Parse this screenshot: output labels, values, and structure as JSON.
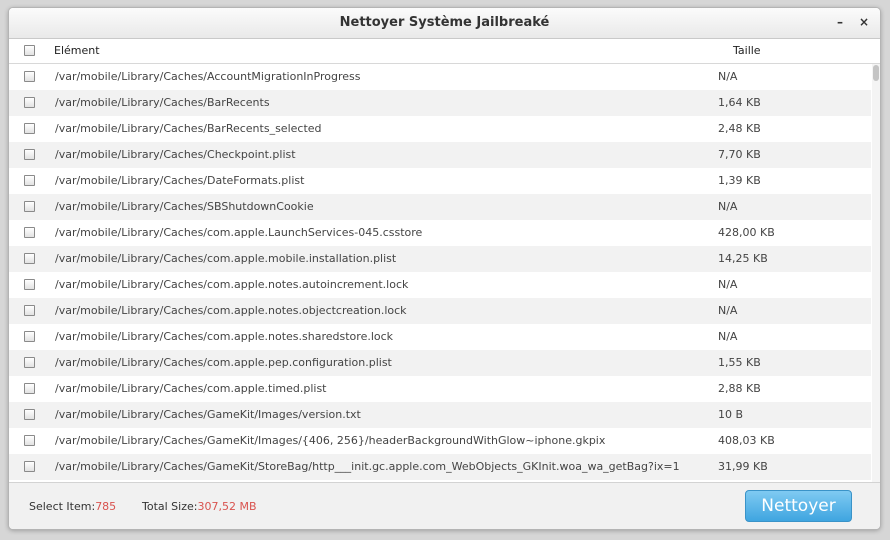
{
  "window": {
    "title": "Nettoyer Système Jailbreaké",
    "minimize": "–",
    "close": "×"
  },
  "table": {
    "col_item": "Elément",
    "col_size": "Taille",
    "rows": [
      {
        "path": "/var/mobile/Library/Caches/AccountMigrationInProgress",
        "size": "N/A"
      },
      {
        "path": "/var/mobile/Library/Caches/BarRecents",
        "size": "1,64 KB"
      },
      {
        "path": "/var/mobile/Library/Caches/BarRecents_selected",
        "size": "2,48 KB"
      },
      {
        "path": "/var/mobile/Library/Caches/Checkpoint.plist",
        "size": "7,70 KB"
      },
      {
        "path": "/var/mobile/Library/Caches/DateFormats.plist",
        "size": "1,39 KB"
      },
      {
        "path": "/var/mobile/Library/Caches/SBShutdownCookie",
        "size": "N/A"
      },
      {
        "path": "/var/mobile/Library/Caches/com.apple.LaunchServices-045.csstore",
        "size": "428,00 KB"
      },
      {
        "path": "/var/mobile/Library/Caches/com.apple.mobile.installation.plist",
        "size": "14,25 KB"
      },
      {
        "path": "/var/mobile/Library/Caches/com.apple.notes.autoincrement.lock",
        "size": "N/A"
      },
      {
        "path": "/var/mobile/Library/Caches/com.apple.notes.objectcreation.lock",
        "size": "N/A"
      },
      {
        "path": "/var/mobile/Library/Caches/com.apple.notes.sharedstore.lock",
        "size": "N/A"
      },
      {
        "path": "/var/mobile/Library/Caches/com.apple.pep.configuration.plist",
        "size": "1,55 KB"
      },
      {
        "path": "/var/mobile/Library/Caches/com.apple.timed.plist",
        "size": "2,88 KB"
      },
      {
        "path": "/var/mobile/Library/Caches/GameKit/Images/version.txt",
        "size": "10 B"
      },
      {
        "path": "/var/mobile/Library/Caches/GameKit/Images/{406, 256}/headerBackgroundWithGlow~iphone.gkpix",
        "size": "408,03 KB"
      },
      {
        "path": "/var/mobile/Library/Caches/GameKit/StoreBag/http___init.gc.apple.com_WebObjects_GKInit.woa_wa_getBag?ix=1",
        "size": "31,99 KB"
      }
    ]
  },
  "footer": {
    "select_label": "Select Item:",
    "select_value": "785",
    "total_label": "Total Size:",
    "total_value": "307,52 MB",
    "clean_button": "Nettoyer"
  },
  "colors": {
    "accent": "#3fa5e0",
    "value": "#d9534f"
  }
}
